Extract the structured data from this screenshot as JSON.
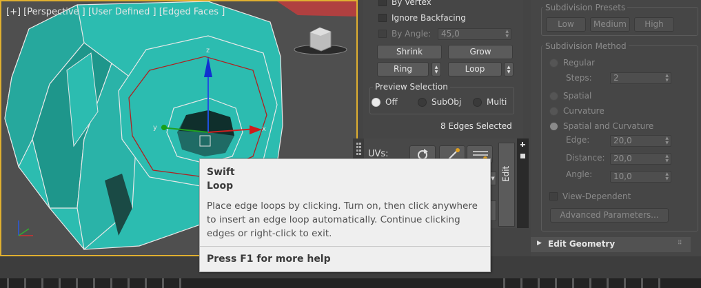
{
  "viewport": {
    "label": "[+] [Perspective ] [User Defined ] [Edged Faces ]",
    "gizmo_axes": {
      "x": "x",
      "y": "y",
      "z": "z"
    }
  },
  "selection": {
    "by_vertex": "By Vertex",
    "ignore_backfacing": "Ignore Backfacing",
    "by_angle": "By Angle:",
    "by_angle_value": "45,0",
    "shrink": "Shrink",
    "grow": "Grow",
    "ring": "Ring",
    "loop": "Loop",
    "preview_selection": "Preview Selection",
    "preview_options": [
      "Off",
      "SubObj",
      "Multi"
    ],
    "preview_selected": "Off",
    "status": "8 Edges Selected"
  },
  "ribbon": {
    "uvs_label": "UVs:",
    "edit_tab": "Edit"
  },
  "subdivision": {
    "presets_title": "Subdivision Presets",
    "presets": [
      "Low",
      "Medium",
      "High"
    ],
    "method_title": "Subdivision Method",
    "regular": "Regular",
    "steps_label": "Steps:",
    "steps_value": "2",
    "spatial": "Spatial",
    "curvature": "Curvature",
    "spatial_and_curvature": "Spatial and Curvature",
    "edge_label": "Edge:",
    "edge_value": "20,0",
    "distance_label": "Distance:",
    "distance_value": "20,0",
    "angle_label": "Angle:",
    "angle_value": "10,0",
    "view_dependent": "View-Dependent",
    "advanced_params": "Advanced Parameters..."
  },
  "edit_geometry": {
    "title": "Edit Geometry"
  },
  "tooltip": {
    "title_line1": "Swift",
    "title_line2": "Loop",
    "body": "Place edge loops by clicking. Turn on, then click anywhere to insert an edge loop automatically. Continue clicking edges or right-click to exit.",
    "help": "Press F1 for more help"
  },
  "colors": {
    "mesh": "#2cbcb0",
    "accent": "#e0b030",
    "panel": "#464646"
  }
}
